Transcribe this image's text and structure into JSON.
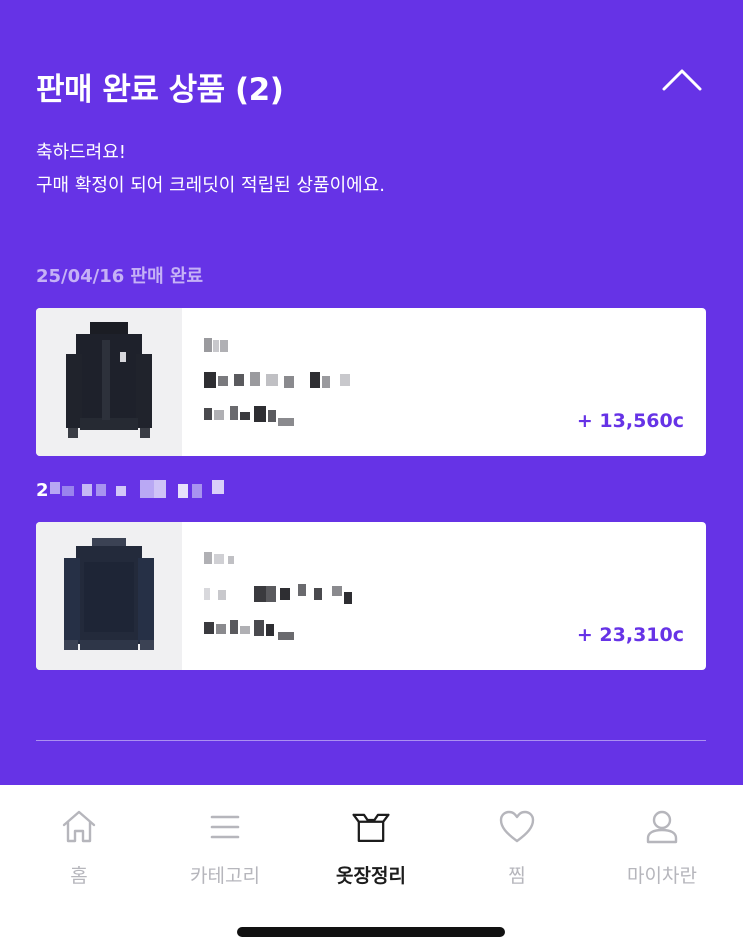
{
  "section": {
    "title": "판매 완료 상품 (2)"
  },
  "message": {
    "line1": "축하드려요!",
    "line2": "구매 확정이 되어 크레딧이 적립된 상품이에요."
  },
  "groups": [
    {
      "date": "25/04/16 판매 완료",
      "item": {
        "amount": "+ 13,560c",
        "image": "black-jacket"
      }
    },
    {
      "date": "2",
      "item": {
        "amount": "+ 23,310c",
        "image": "navy-sweater"
      }
    }
  ],
  "tabs": [
    {
      "label": "홈",
      "icon": "home-icon"
    },
    {
      "label": "카테고리",
      "icon": "menu-icon"
    },
    {
      "label": "옷장정리",
      "icon": "box-icon",
      "active": true
    },
    {
      "label": "찜",
      "icon": "heart-icon"
    },
    {
      "label": "마이차란",
      "icon": "person-icon"
    }
  ],
  "colors": {
    "accent": "#6633e6",
    "tab_inactive": "#b6b6bc",
    "tab_active": "#1c1c1c"
  }
}
